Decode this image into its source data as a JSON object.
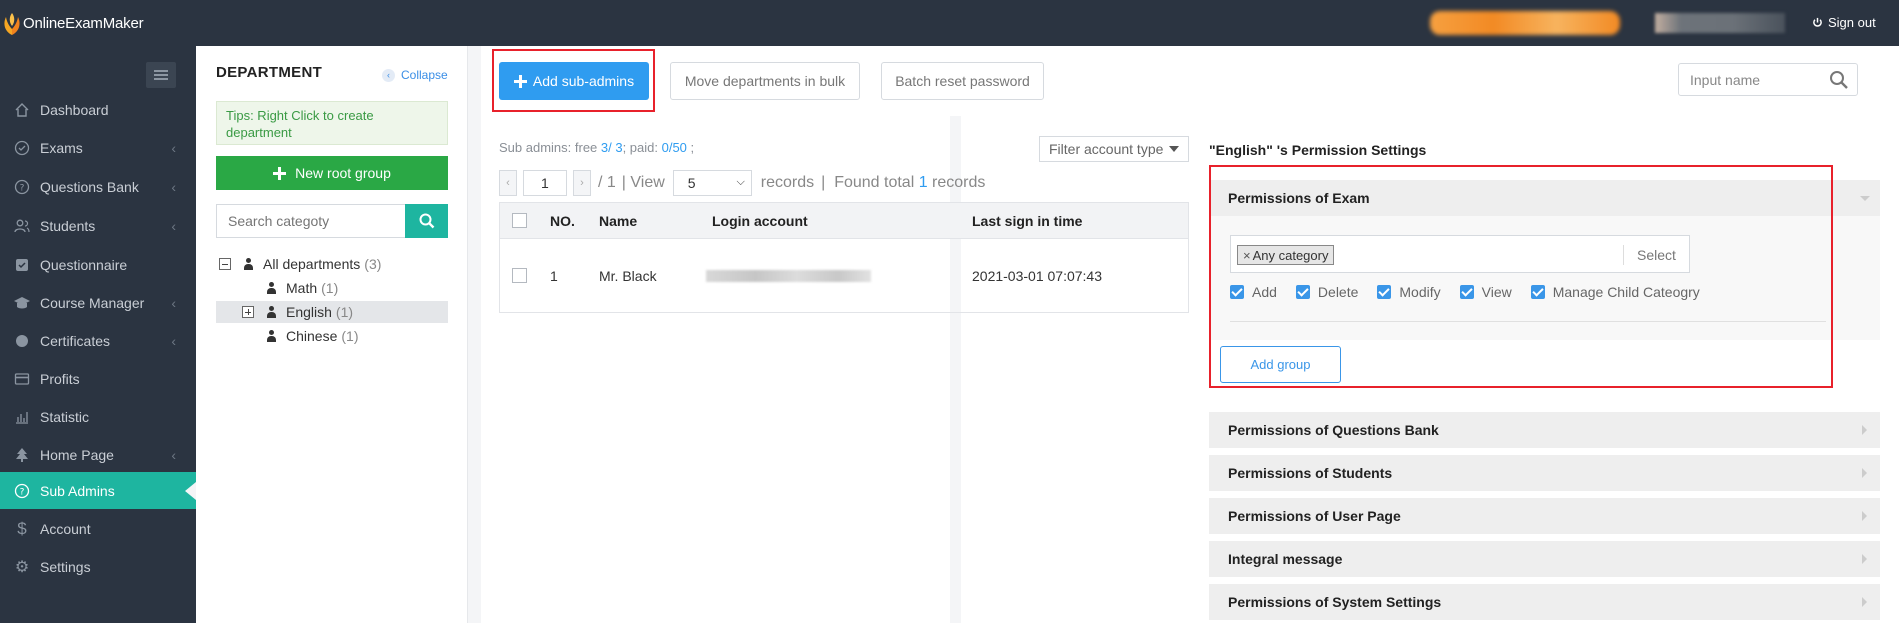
{
  "app": {
    "logo_text": "OnlineExamMaker",
    "sign_out": "Sign out"
  },
  "sidebar": {
    "items": [
      {
        "label": "Dashboard",
        "icon": "home-icon",
        "chevron": false,
        "active": false
      },
      {
        "label": "Exams",
        "icon": "check-circle-icon",
        "chevron": true,
        "active": false
      },
      {
        "label": "Questions Bank",
        "icon": "question-circle-icon",
        "chevron": true,
        "active": false
      },
      {
        "label": "Students",
        "icon": "users-icon",
        "chevron": true,
        "active": false
      },
      {
        "label": "Questionnaire",
        "icon": "checkbox-icon",
        "chevron": false,
        "active": false
      },
      {
        "label": "Course Manager",
        "icon": "graduation-cap-icon",
        "chevron": true,
        "active": false
      },
      {
        "label": "Certificates",
        "icon": "circle-icon",
        "chevron": true,
        "active": false
      },
      {
        "label": "Profits",
        "icon": "card-icon",
        "chevron": false,
        "active": false
      },
      {
        "label": "Statistic",
        "icon": "bar-chart-icon",
        "chevron": false,
        "active": false
      },
      {
        "label": "Home Page",
        "icon": "tree-icon",
        "chevron": true,
        "active": false
      },
      {
        "label": "Sub Admins",
        "icon": "question-circle-icon",
        "chevron": false,
        "active": true
      },
      {
        "label": "Account",
        "icon": "dollar-icon",
        "chevron": false,
        "active": false
      },
      {
        "label": "Settings",
        "icon": "gear-icon",
        "chevron": false,
        "active": false
      }
    ]
  },
  "department": {
    "title": "DEPARTMENT",
    "collapse": "Collapse",
    "tips": "Tips:  Right Click to create department",
    "new_root": "New root group",
    "search_placeholder": "Search categoty",
    "tree": [
      {
        "label": "All departments",
        "count": "(3)"
      },
      {
        "label": "Math",
        "count": "(1)"
      },
      {
        "label": "English",
        "count": "(1)"
      },
      {
        "label": "Chinese",
        "count": "(1)"
      }
    ]
  },
  "toolbar": {
    "add_sub_admins": "Add sub-admins",
    "move_departments": "Move departments in bulk",
    "batch_reset": "Batch reset password",
    "input_name_placeholder": "Input name"
  },
  "list": {
    "sub_admins_prefix": "Sub admins: free ",
    "free": "3/ 3",
    "paid_prefix": "; paid: ",
    "paid": "0/50",
    "suffix": " ;",
    "filter": "Filter account type",
    "page": "1",
    "total_pages": "/ 1",
    "view_label": "| View",
    "page_size": "5",
    "records_label": "records",
    "found_prefix": "|  Found total ",
    "found_count": "1",
    "found_suffix": " records",
    "columns": [
      "NO.",
      "Name",
      "Login account",
      "Last sign in time"
    ],
    "rows": [
      {
        "no": "1",
        "name": "Mr. Black",
        "last_sign_in": "2021-03-01 07:07:43"
      }
    ]
  },
  "permissions": {
    "title": "\"English\" 's Permission Settings",
    "exam_header": "Permissions of Exam",
    "tag": "Any category",
    "tag_remove": "×",
    "select": "Select",
    "checks": [
      "Add",
      "Delete",
      "Modify",
      "View",
      "Manage Child Cateogry"
    ],
    "add_group": "Add group",
    "sections": [
      "Permissions of Questions Bank",
      "Permissions of Students",
      "Permissions of User Page",
      "Integral message",
      "Permissions of System Settings"
    ]
  },
  "colors": {
    "accent": "#1eb5a0",
    "primary": "#2f9cf0",
    "highlight": "#e8212b",
    "sidebar": "#2b3441"
  }
}
